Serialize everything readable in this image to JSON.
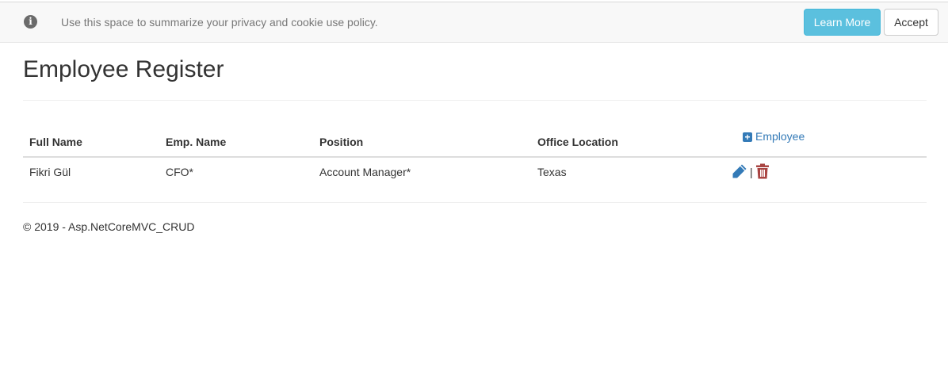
{
  "cookie_banner": {
    "message": "Use this space to summarize your privacy and cookie use policy.",
    "learn_more_label": "Learn More",
    "accept_label": "Accept",
    "info_icon_glyph": "i"
  },
  "page": {
    "title": "Employee Register"
  },
  "table": {
    "headers": {
      "full_name": "Full Name",
      "emp_name": "Emp. Name",
      "position": "Position",
      "office_location": "Office Location"
    },
    "add_employee_label": "Employee",
    "rows": [
      {
        "full_name": "Fikri Gül",
        "emp_name": "CFO*",
        "position": "Account Manager*",
        "office_location": "Texas",
        "separator": "|"
      }
    ]
  },
  "footer": {
    "text": "© 2019 - Asp.NetCoreMVC_CRUD"
  },
  "colors": {
    "link_blue": "#337ab7",
    "info_button": "#5bc0de",
    "delete_red": "#a94442"
  },
  "icons": {
    "info": "info-circle-icon",
    "add": "plus-square-icon",
    "edit": "pencil-icon",
    "delete": "trash-icon"
  }
}
